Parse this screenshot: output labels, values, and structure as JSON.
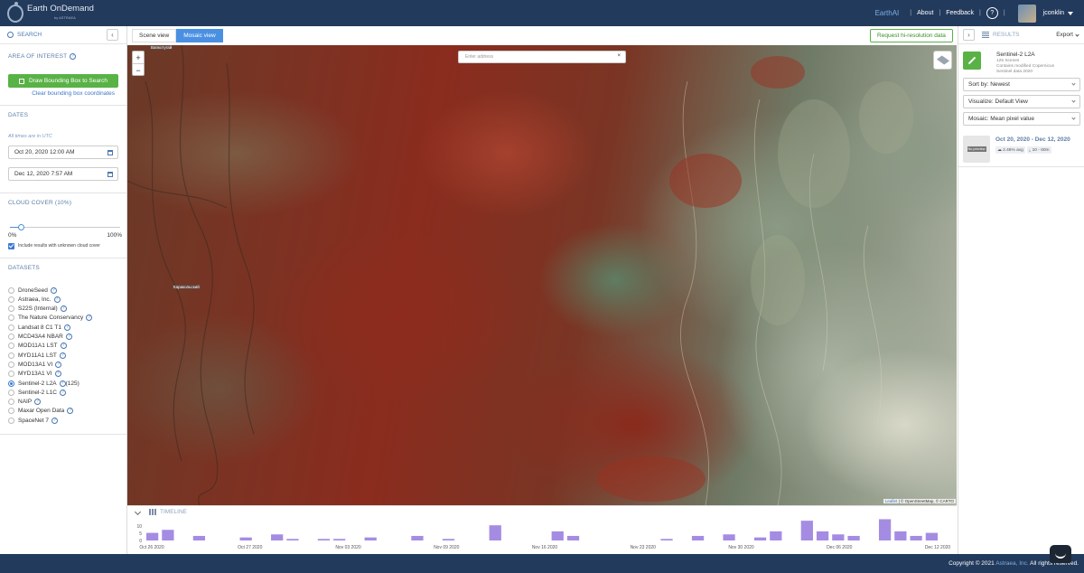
{
  "header": {
    "brand": "Earth OnDemand",
    "brand_sub": "by ASTRAEA",
    "nav": {
      "earthai": "EarthAI",
      "about": "About",
      "feedback": "Feedback",
      "help": "?",
      "username": "jconklin"
    }
  },
  "left_panel": {
    "search_label": "SEARCH",
    "collapse": "‹",
    "aoi": {
      "title": "AREA OF INTEREST",
      "draw_button": "Draw Bounding Box to Search",
      "clear_link": "Clear bounding box coordinates"
    },
    "dates": {
      "title": "DATES",
      "hint": "All times are in UTC",
      "start": "Oct 20, 2020 12:00 AM",
      "end": "Dec 12, 2020 7:57 AM"
    },
    "cloud": {
      "title": "CLOUD COVER (10%)",
      "value_percent": 10,
      "min": "0%",
      "max": "100%",
      "unknown_label": "Include results with unknown cloud cover"
    },
    "datasets": {
      "title": "DATASETS",
      "items": [
        {
          "label": "DroneSeed",
          "selected": false,
          "count": ""
        },
        {
          "label": "Astraea, Inc.",
          "selected": false,
          "count": ""
        },
        {
          "label": "S22S (Internal)",
          "selected": false,
          "count": ""
        },
        {
          "label": "The Nature Conservancy",
          "selected": false,
          "count": ""
        },
        {
          "label": "Landsat 8 C1 T1",
          "selected": false,
          "count": ""
        },
        {
          "label": "MCD43A4 NBAR",
          "selected": false,
          "count": ""
        },
        {
          "label": "MOD11A1 LST",
          "selected": false,
          "count": ""
        },
        {
          "label": "MYD11A1 LST",
          "selected": false,
          "count": ""
        },
        {
          "label": "MOD13A1 VI",
          "selected": false,
          "count": ""
        },
        {
          "label": "MYD13A1 VI",
          "selected": false,
          "count": ""
        },
        {
          "label": "Sentinel-2 L2A",
          "selected": true,
          "count": "(125)"
        },
        {
          "label": "Sentinel-2 L1C",
          "selected": false,
          "count": ""
        },
        {
          "label": "NAIP",
          "selected": false,
          "count": ""
        },
        {
          "label": "Maxar Open Data",
          "selected": false,
          "count": ""
        },
        {
          "label": "SpaceNet 7",
          "selected": false,
          "count": ""
        }
      ]
    }
  },
  "toolbar": {
    "scene_view": "Scene view",
    "mosaic_view": "Mosaic view",
    "request_hires": "Request hi-resolution data"
  },
  "map": {
    "address_placeholder": "Enter address",
    "address_clear": "×",
    "zoom_in": "+",
    "zoom_out": "−",
    "place_1": "Вапкотугай",
    "place_2": "Каракольский",
    "attribution_leaflet": "Leaflet",
    "attribution_rest": "| © OpenStreetMap, © CARTO"
  },
  "timeline": {
    "title": "TIMELINE",
    "y_ticks": [
      "10",
      "5",
      "0"
    ],
    "dates": [
      "Oct 26 2020",
      "Oct 27 2020",
      "Nov 03 2020",
      "Nov 09 2020",
      "Nov 16 2020",
      "Nov 23 2020",
      "Nov 30 2020",
      "Dec 06 2020",
      "Dec 12 2020"
    ],
    "counts": [
      5,
      7,
      0,
      3,
      0,
      0,
      2,
      0,
      4,
      1,
      0,
      1,
      1,
      0,
      2,
      0,
      0,
      3,
      0,
      1,
      0,
      0,
      10,
      0,
      0,
      0,
      6,
      3,
      0,
      0,
      0,
      0,
      0,
      1,
      0,
      3,
      0,
      4,
      0,
      2,
      6,
      0,
      13,
      6,
      4,
      3,
      0,
      14,
      6,
      3,
      5
    ]
  },
  "right_panel": {
    "results_label": "RESULTS",
    "export": "Export",
    "dataset_name": "Sentinel-2 L2A",
    "scenes": "125 Scenes",
    "meta_1": "Contains modified Copernicus",
    "meta_2": "Sentinel data 2020",
    "sort": "Sort by: Newest",
    "visualize": "Visualize: Default View",
    "mosaic": "Mosaic: Mean pixel value",
    "result": {
      "no_preview": "No preview",
      "date_range": "Oct 20, 2020 - Dec 12, 2020",
      "cloud": "2.46% avg",
      "resolution": "10 - 60m"
    }
  },
  "footer": {
    "copyright_prefix": "Copyright © 2021",
    "company": "Astraea, Inc.",
    "rights": "All rights reserved."
  },
  "colors": {
    "header": "#223a5c",
    "accent_green": "#59b246",
    "accent_blue": "#4a90e2",
    "bar": "#a58ce3"
  }
}
